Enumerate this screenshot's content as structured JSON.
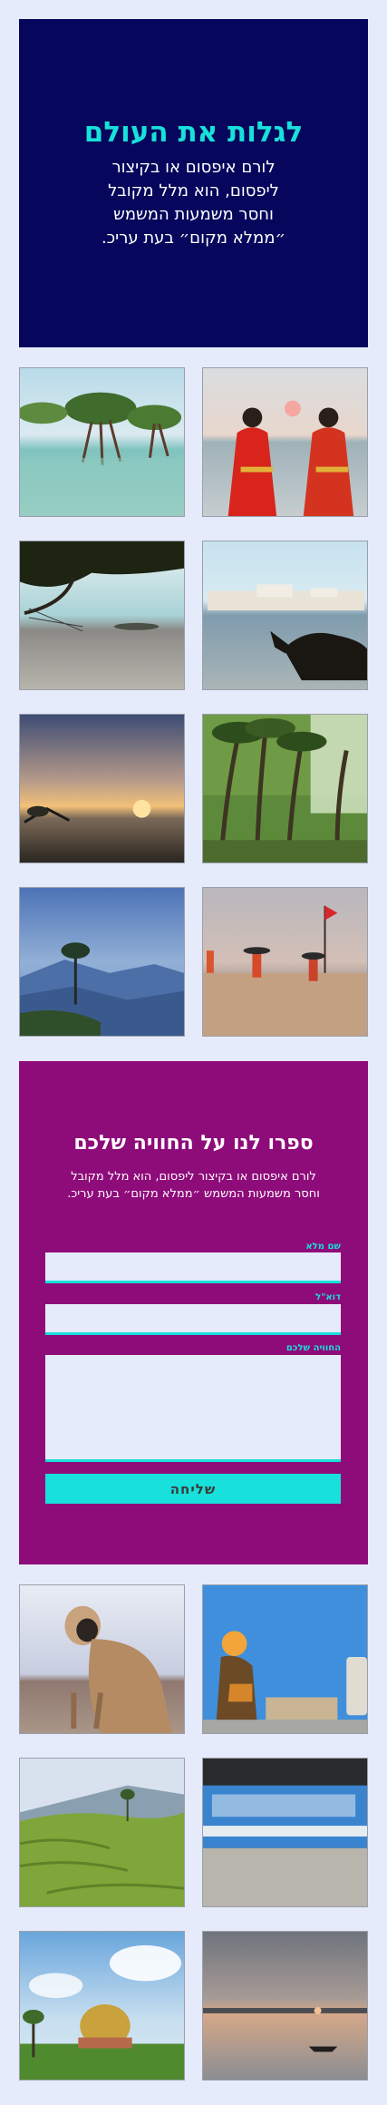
{
  "hero": {
    "title": "לגלות את העולם",
    "text": "לורם איפסום או בקיצור ליפסום, הוא מלל מקובל וחסר משמעות המשמש ״ממלא מקום״ בעת עריכ."
  },
  "gallery_top": [
    {
      "icon": "mangrove-beach-photo"
    },
    {
      "icon": "women-sunset-sea-photo"
    },
    {
      "icon": "tree-branch-beach-photo"
    },
    {
      "icon": "cow-river-town-photo"
    },
    {
      "icon": "sunset-mudflat-photo"
    },
    {
      "icon": "palm-forest-photo"
    },
    {
      "icon": "misty-mountain-tree-photo"
    },
    {
      "icon": "beach-people-flag-photo"
    }
  ],
  "form": {
    "title": "ספרו לנו על החוויה שלכם",
    "intro": "לורם איפסום או בקיצור ליפסום, הוא מלל מקובל וחסר משמעות המשמש ״ממלא מקום״ בעת עריכ.",
    "name_label": "שם מלא",
    "email_label": "דוא\"ל",
    "experience_label": "החוויה שלכם",
    "name_value": "",
    "email_value": "",
    "experience_value": "",
    "submit_label": "שליחה"
  },
  "gallery_bottom": [
    {
      "icon": "monkey-photo"
    },
    {
      "icon": "sadhu-blue-wall-photo"
    },
    {
      "icon": "tea-plantation-photo"
    },
    {
      "icon": "moving-train-photo"
    },
    {
      "icon": "golden-dome-photo"
    },
    {
      "icon": "boat-sunset-photo"
    }
  ],
  "colors": {
    "page_bg": "#e6ebfb",
    "hero_bg": "#05065c",
    "accent": "#18e0da",
    "form_bg": "#8e0b7a"
  }
}
